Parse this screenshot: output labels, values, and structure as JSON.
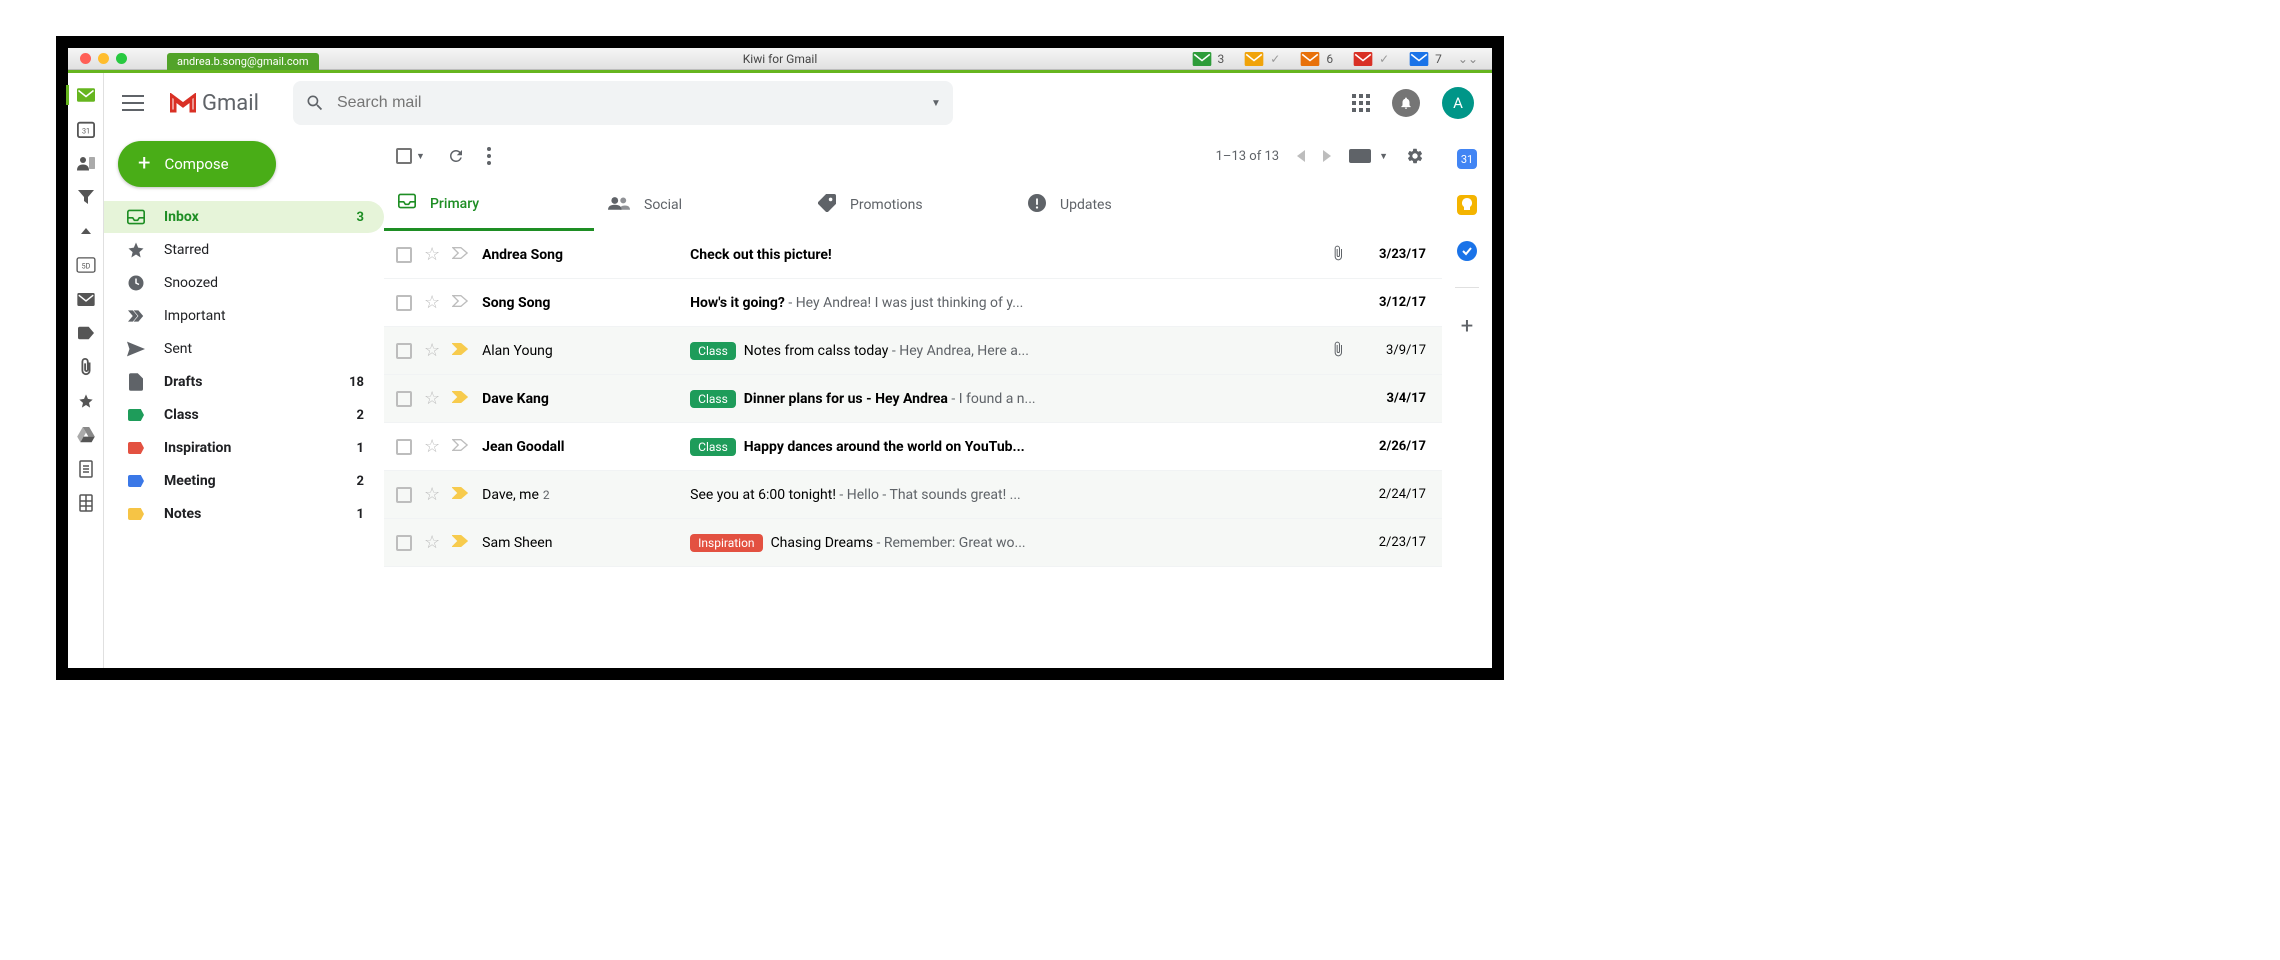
{
  "titlebar": {
    "account_chip": "andrea.b.song@gmail.com",
    "title": "Kiwi for Gmail",
    "badges": [
      {
        "color": "#2e9c3a",
        "count": "3",
        "check": false
      },
      {
        "color": "#f0a30a",
        "count": "",
        "check": true
      },
      {
        "color": "#e8710a",
        "count": "6",
        "check": false
      },
      {
        "color": "#d93025",
        "count": "",
        "check": true
      },
      {
        "color": "#1a73e8",
        "count": "7",
        "check": false
      }
    ]
  },
  "leftstrip": {
    "items": [
      {
        "name": "mail",
        "active": true
      },
      {
        "name": "calendar-31"
      },
      {
        "name": "contacts"
      },
      {
        "name": "filter"
      },
      {
        "name": "collapse-up"
      },
      {
        "name": "calendar-5d"
      },
      {
        "name": "mail-alt"
      },
      {
        "name": "tag"
      },
      {
        "name": "attach"
      },
      {
        "name": "star"
      },
      {
        "name": "drive"
      },
      {
        "name": "docs"
      },
      {
        "name": "sheets"
      }
    ]
  },
  "topbar": {
    "brand": "Gmail",
    "search_placeholder": "Search mail",
    "avatar_initial": "A"
  },
  "compose": {
    "label": "Compose"
  },
  "sidebar": {
    "items": [
      {
        "label": "Inbox",
        "count": "3",
        "icon": "inbox",
        "active": true,
        "bold": true
      },
      {
        "label": "Starred",
        "icon": "star"
      },
      {
        "label": "Snoozed",
        "icon": "clock"
      },
      {
        "label": "Important",
        "icon": "important"
      },
      {
        "label": "Sent",
        "icon": "sent"
      },
      {
        "label": "Drafts",
        "count": "18",
        "icon": "drafts",
        "bold": true
      },
      {
        "label": "Class",
        "count": "2",
        "icon": "label",
        "color": "#1e9c5a",
        "bold": true
      },
      {
        "label": "Inspiration",
        "count": "1",
        "icon": "label",
        "color": "#e35141",
        "bold": true
      },
      {
        "label": "Meeting",
        "count": "2",
        "icon": "label",
        "color": "#3b78e7",
        "bold": true
      },
      {
        "label": "Notes",
        "count": "1",
        "icon": "label",
        "color": "#f6c445",
        "bold": true
      }
    ]
  },
  "toolbar": {
    "range": "1–13 of 13"
  },
  "categories": [
    {
      "label": "Primary",
      "icon": "primary",
      "active": true
    },
    {
      "label": "Social",
      "icon": "social"
    },
    {
      "label": "Promotions",
      "icon": "promotions"
    },
    {
      "label": "Updates",
      "icon": "updates"
    }
  ],
  "messages": [
    {
      "sender": "Andrea Song",
      "subject": "Check out this picture!",
      "snippet": "",
      "label": null,
      "date": "3/23/17",
      "attach": true,
      "unread": true,
      "important": false,
      "alt": false
    },
    {
      "sender": "Song Song",
      "subject": "How's it going?",
      "snippet": " - Hey Andrea! I was just thinking of y...",
      "label": null,
      "date": "3/12/17",
      "attach": false,
      "unread": true,
      "important": false,
      "alt": false
    },
    {
      "sender": "Alan Young",
      "subject": "Notes from calss today",
      "snippet": " - Hey Andrea, Here a...",
      "label": {
        "text": "Class",
        "color": "#1e9c5a"
      },
      "date": "3/9/17",
      "attach": true,
      "unread": false,
      "important": true,
      "alt": true
    },
    {
      "sender": "Dave Kang",
      "subject": "Dinner plans for us - Hey Andrea",
      "snippet": " - I found a n...",
      "label": {
        "text": "Class",
        "color": "#1e9c5a"
      },
      "date": "3/4/17",
      "attach": false,
      "unread": true,
      "important": true,
      "alt": true
    },
    {
      "sender": "Jean Goodall",
      "subject": "Happy dances around the world on YouTub...",
      "snippet": "",
      "label": {
        "text": "Class",
        "color": "#1e9c5a"
      },
      "date": "2/26/17",
      "attach": false,
      "unread": true,
      "important": false,
      "alt": false
    },
    {
      "sender": "Dave, me",
      "thread": "2",
      "subject": "See you at 6:00 tonight!",
      "snippet": " - Hello - That sounds great! ...",
      "label": null,
      "date": "2/24/17",
      "attach": false,
      "unread": false,
      "important": true,
      "alt": true
    },
    {
      "sender": "Sam Sheen",
      "subject": "Chasing Dreams",
      "snippet": " - Remember: Great wo...",
      "label": {
        "text": "Inspiration",
        "color": "#e35141"
      },
      "date": "2/23/17",
      "attach": false,
      "unread": false,
      "important": true,
      "alt": true
    }
  ],
  "rightbar": [
    {
      "name": "calendar",
      "color": "#4285f4",
      "text": "31"
    },
    {
      "name": "keep",
      "color": "#f4b400",
      "text": ""
    },
    {
      "name": "tasks",
      "color": "#1a73e8",
      "text": ""
    }
  ]
}
